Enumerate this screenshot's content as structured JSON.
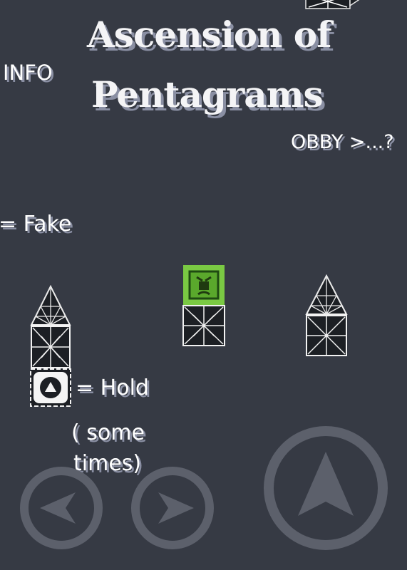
{
  "title": {
    "line1": "Ascension of",
    "line2": "Pentagrams"
  },
  "labels": {
    "info": "INFO",
    "obby": "OBBY >...?",
    "fake": "= Fake",
    "hold": "= Hold",
    "sometimes_line1": "( some",
    "sometimes_line2": "times)"
  },
  "controls": {
    "left": "left-arrow-icon",
    "right": "right-arrow-icon",
    "jump": "jump-arrow-icon"
  },
  "colors": {
    "background": "#363a44",
    "player": "#7ac943",
    "control_ring": "#5c606b",
    "text_shadow": "#8a8fa3"
  }
}
